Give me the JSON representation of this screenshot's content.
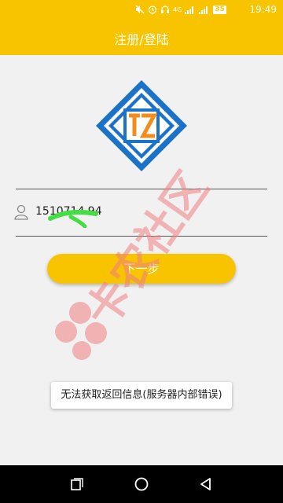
{
  "status_bar": {
    "battery": "35",
    "time": "19:49",
    "network": "4G"
  },
  "app_bar": {
    "title": "注册/登陆"
  },
  "login": {
    "phone_value": "1510714 94",
    "next_button": "下一步"
  },
  "toast": {
    "message": "无法获取返回信息(服务器内部错误)"
  },
  "watermark": {
    "text": "卡农社区"
  },
  "nav_bar": {
    "recent_icon": "recent-apps-icon",
    "home_icon": "home-icon",
    "back_icon": "back-icon"
  },
  "colors": {
    "accent": "#f8c400",
    "logo_blue": "#1a73c8",
    "logo_orange": "#f28c1c",
    "watermark": "#f08080"
  }
}
